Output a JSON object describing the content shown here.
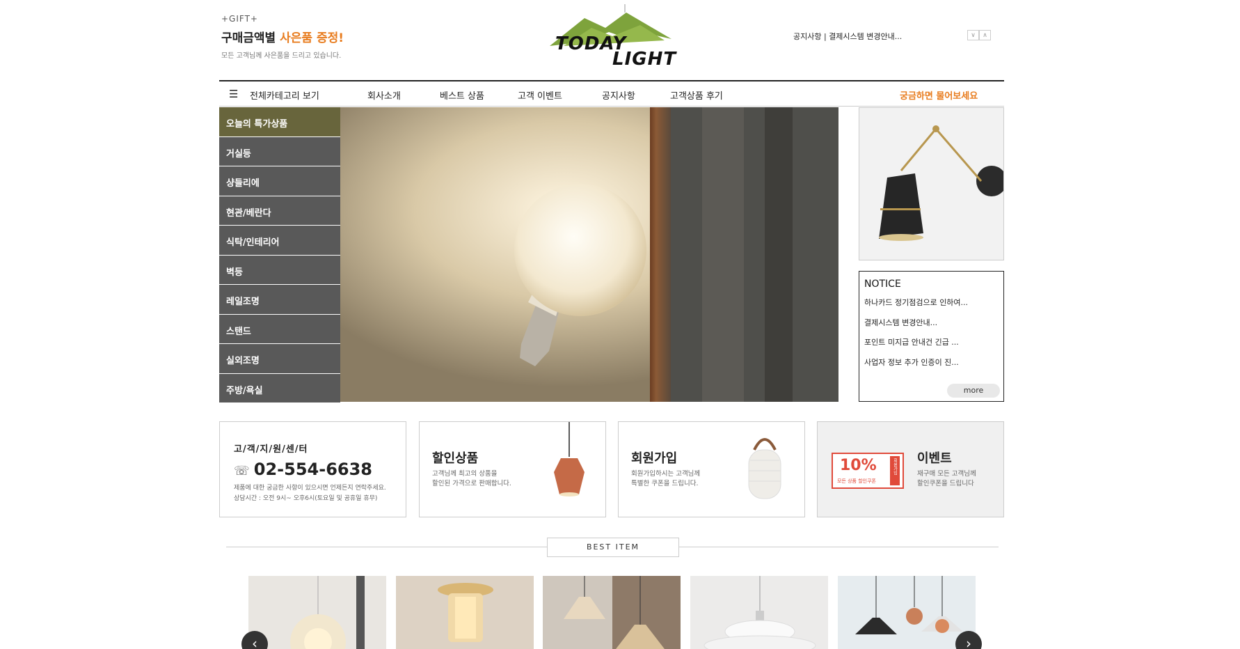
{
  "header": {
    "gift_tag": "+GIFT+",
    "gift_title_main": "구매금액별 ",
    "gift_title_accent": "사은품 증정!",
    "gift_sub": "모든 고객님께 사은품을 드리고 있습니다.",
    "logo_line1": "TODAY",
    "logo_line2": "LIGHT",
    "ticker_text": "공지사항 |  결제시스템 변경안내..."
  },
  "nav": {
    "all_categories": "전체카테고리 보기",
    "items": [
      "회사소개",
      "베스트 상품",
      "고객 이벤트",
      "공지사항",
      "고객상품 후기"
    ],
    "ask": "궁금하면 물어보세요"
  },
  "categories": [
    "오늘의 특가상품",
    "거실등",
    "샹들리에",
    "현관/베란다",
    "식탁/인테리어",
    "벽등",
    "레일조명",
    "스탠드",
    "실외조명",
    "주방/욕실"
  ],
  "notice": {
    "title": "NOTICE",
    "items": [
      "하나카드 정기점검으로 인하여...",
      "결제시스템 변경안내...",
      "포인트 미지급 안내건 긴급 ...",
      "사업자 정보 추가 인증이 진..."
    ],
    "more": "more"
  },
  "support": {
    "title": "고/객/지/원/센/터",
    "phone": "02-554-6638",
    "desc1": "제품에 대한 궁금한 사항이 있으시면 언제든지 연락주세요.",
    "desc2": "상담시간 : 오전 9시~ 오후6시(토요일 및 공휴일 휴무)"
  },
  "sale": {
    "title": "할인상품",
    "desc1": "고객님께 최고의 상품을",
    "desc2": "할인된 가격으로 판매합니다."
  },
  "join": {
    "title": "회원가입",
    "desc1": "회원가입하시는 고객님께",
    "desc2": "특별한 쿠폰을 드립니다."
  },
  "event": {
    "title": "이벤트",
    "desc1": "재구매 모든 고객님께",
    "desc2": "할인쿠폰을 드립니다",
    "coupon_pct": "10%",
    "coupon_text": "모든 상품 할인쿠폰",
    "coupon_side": "회원가입"
  },
  "best": {
    "title": "BEST ITEM"
  },
  "colors": {
    "accent": "#e87c1e",
    "sidebar": "#595959",
    "sidebar_active": "#68653c",
    "logo_green": "#7ea33c",
    "coupon_red": "#e04a3a"
  }
}
